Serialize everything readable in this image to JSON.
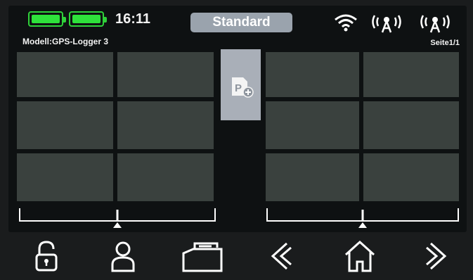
{
  "status": {
    "time": "16:11",
    "mode": "Standard",
    "colors": {
      "battery": "#2ee23b",
      "mode_bg": "#9aa3ad",
      "cell": "#3a413e",
      "panel": "#a9afb8"
    },
    "icons": [
      "battery-icon",
      "battery-icon",
      "wifi-icon",
      "signal-antenna-icon",
      "signal-antenna-icon"
    ]
  },
  "model": {
    "label": "Modell:GPS-Logger 3"
  },
  "page": {
    "label": "Seite1/1"
  },
  "add_panel": {
    "icon": "add-page-icon",
    "glyph": "P"
  },
  "left_grid": {
    "cells": 6
  },
  "right_grid": {
    "cells": 6
  },
  "trims": [
    {
      "name": "left-trim",
      "value": 0.5
    },
    {
      "name": "right-trim",
      "value": 0.5
    }
  ],
  "nav": {
    "icons": [
      "unlock-icon",
      "user-icon",
      "model-box-icon",
      "back-icon",
      "home-icon",
      "forward-icon"
    ]
  }
}
